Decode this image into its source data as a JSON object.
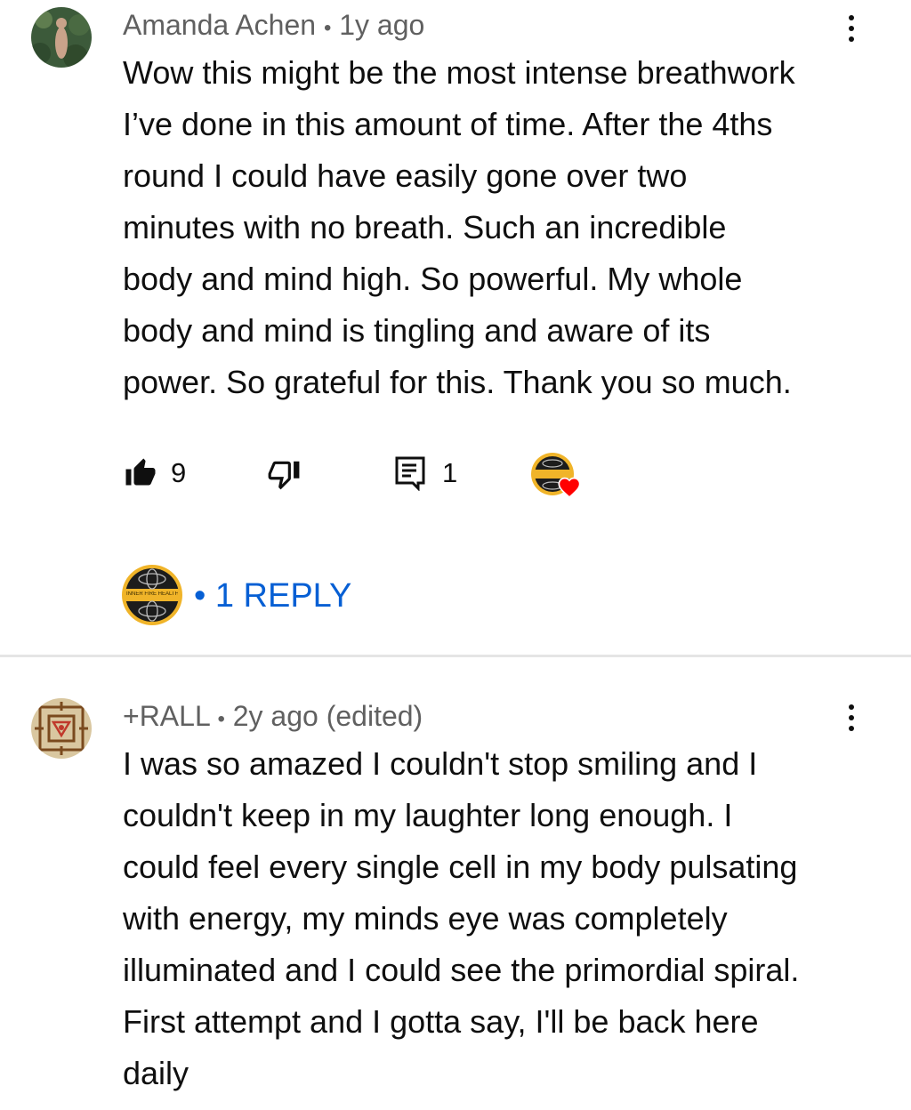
{
  "comments": [
    {
      "author": "Amanda Achen",
      "separator": "•",
      "time": "1y ago",
      "text": "Wow this might be the most intense breathwork\nI’ve done in this amount of time. After the 4ths\nround I could have easily gone over two\nminutes with no breath. Such an incredible\nbody and mind high. So powerful. My whole\nbody and mind is tingling and aware of its\npower. So grateful for this. Thank you so much.",
      "likes": "9",
      "replies_count": "1",
      "reply_label": "• 1 REPLY",
      "creator_badge_text": "INNER FIRE HEALTH"
    },
    {
      "author": "+RALL",
      "separator": "•",
      "time": "2y ago (edited)",
      "text": "I was so amazed I couldn't stop smiling and I\ncouldn't keep in my laughter long enough. I\ncould feel every single cell in my body pulsating\nwith energy, my minds eye was completely\nilluminated and I could see the primordial spiral.\nFirst attempt and I gotta say, I'll be back here\ndaily"
    }
  ],
  "icons": {
    "like": "thumbs-up-icon",
    "dislike": "thumbs-down-icon",
    "reply": "reply-comment-icon",
    "heart": "heart-icon",
    "more": "more-vert-icon"
  },
  "colors": {
    "link": "#065fd4",
    "meta": "#606060",
    "heart": "#ff0000",
    "badge_gold": "#f0b429"
  }
}
